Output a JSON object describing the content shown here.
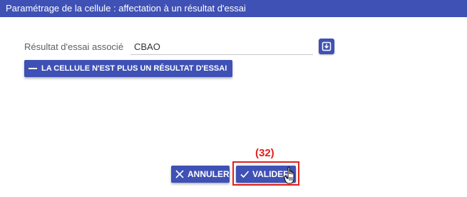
{
  "dialog": {
    "title": "Paramétrage de la cellule : affectation à un résultat d'essai"
  },
  "form": {
    "label": "Résultat d'essai associé",
    "value": "CBAO",
    "select_icon": "download-icon"
  },
  "actions": {
    "unlink_label": "LA CELLULE N'EST PLUS UN RÉSULTAT D'ESSAI",
    "cancel_label": "ANNULER",
    "validate_label": "VALIDER"
  },
  "annotation": {
    "step": "(32)",
    "color": "#e0201c"
  },
  "theme": {
    "primary": "#3f51b5"
  }
}
